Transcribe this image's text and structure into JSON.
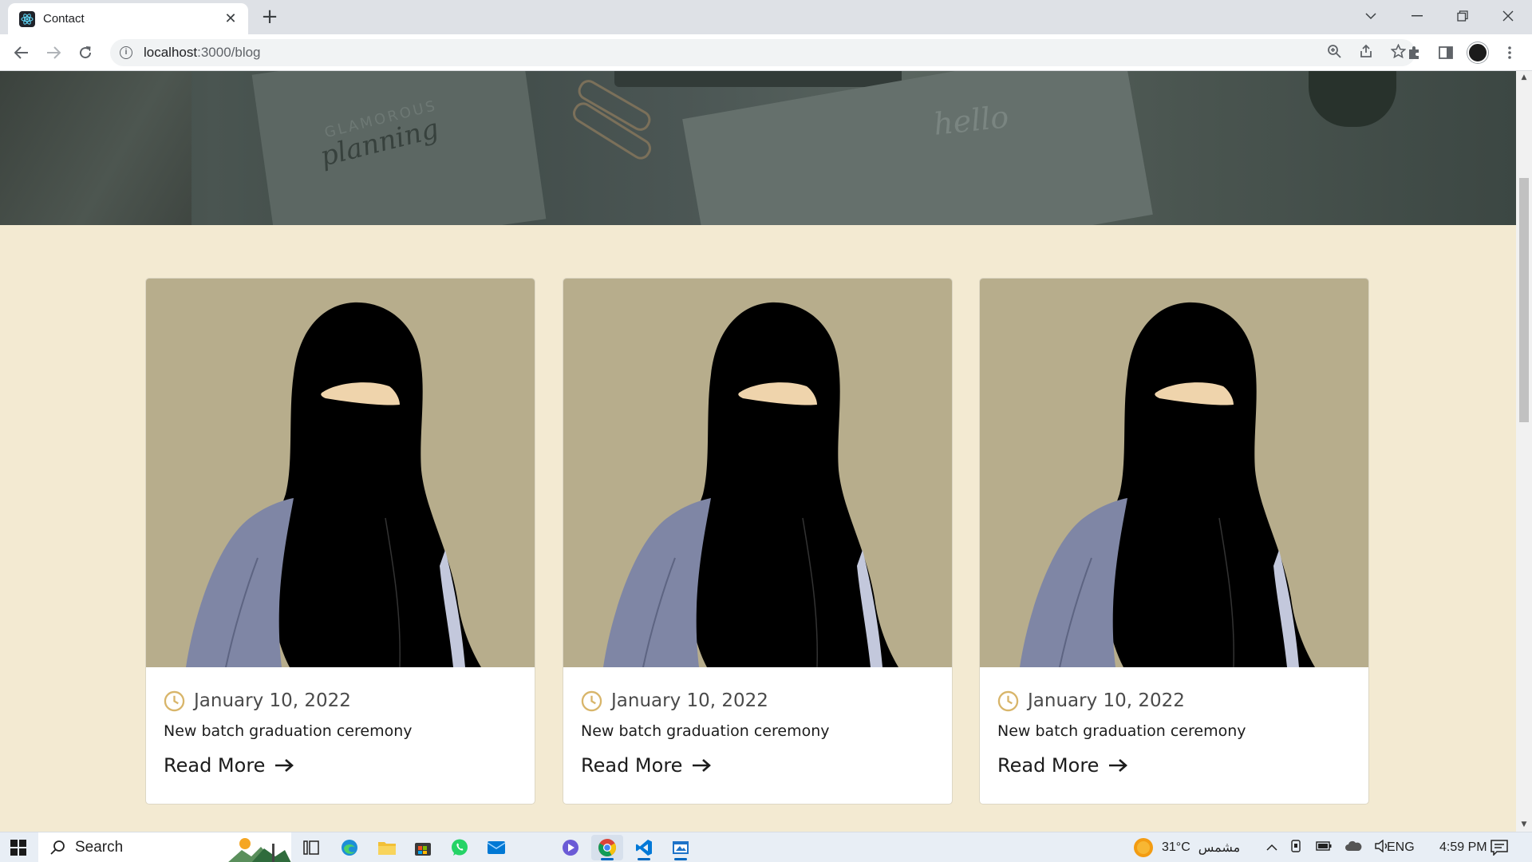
{
  "browser": {
    "tab_title": "Contact",
    "tab_close": "✕",
    "new_tab": "+",
    "url_host": "localhost",
    "url_rest": ":3000/blog"
  },
  "page": {
    "hero": {
      "notebook_text": "GLAMOROUS",
      "notebook_script": "planning",
      "hello_text": "hello"
    },
    "posts": [
      {
        "date": "January 10, 2022",
        "title": "New batch graduation ceremony",
        "read_more": "Read More"
      },
      {
        "date": "January 10, 2022",
        "title": "New batch graduation ceremony",
        "read_more": "Read More"
      },
      {
        "date": "January 10, 2022",
        "title": "New batch graduation ceremony",
        "read_more": "Read More"
      }
    ]
  },
  "taskbar": {
    "search_label": "Search",
    "weather_temp": "31°C",
    "weather_desc": "مشمس",
    "lang": "ENG",
    "time": "4:59 PM"
  },
  "colors": {
    "page_bg": "#f3ead2",
    "card_image_bg": "#b7ad8c",
    "clock_icon": "#d8b56a",
    "niqab": "#000000",
    "robe": "#7f86a5"
  },
  "icons": [
    "react-icon",
    "back-icon",
    "forward-icon",
    "reload-icon",
    "info-icon",
    "zoom-icon",
    "share-icon",
    "star-icon",
    "extensions-icon",
    "sidepanel-icon",
    "profile-icon",
    "menu-icon",
    "clock-icon",
    "arrow-right-icon",
    "windows-icon",
    "search-icon",
    "sun-icon"
  ]
}
